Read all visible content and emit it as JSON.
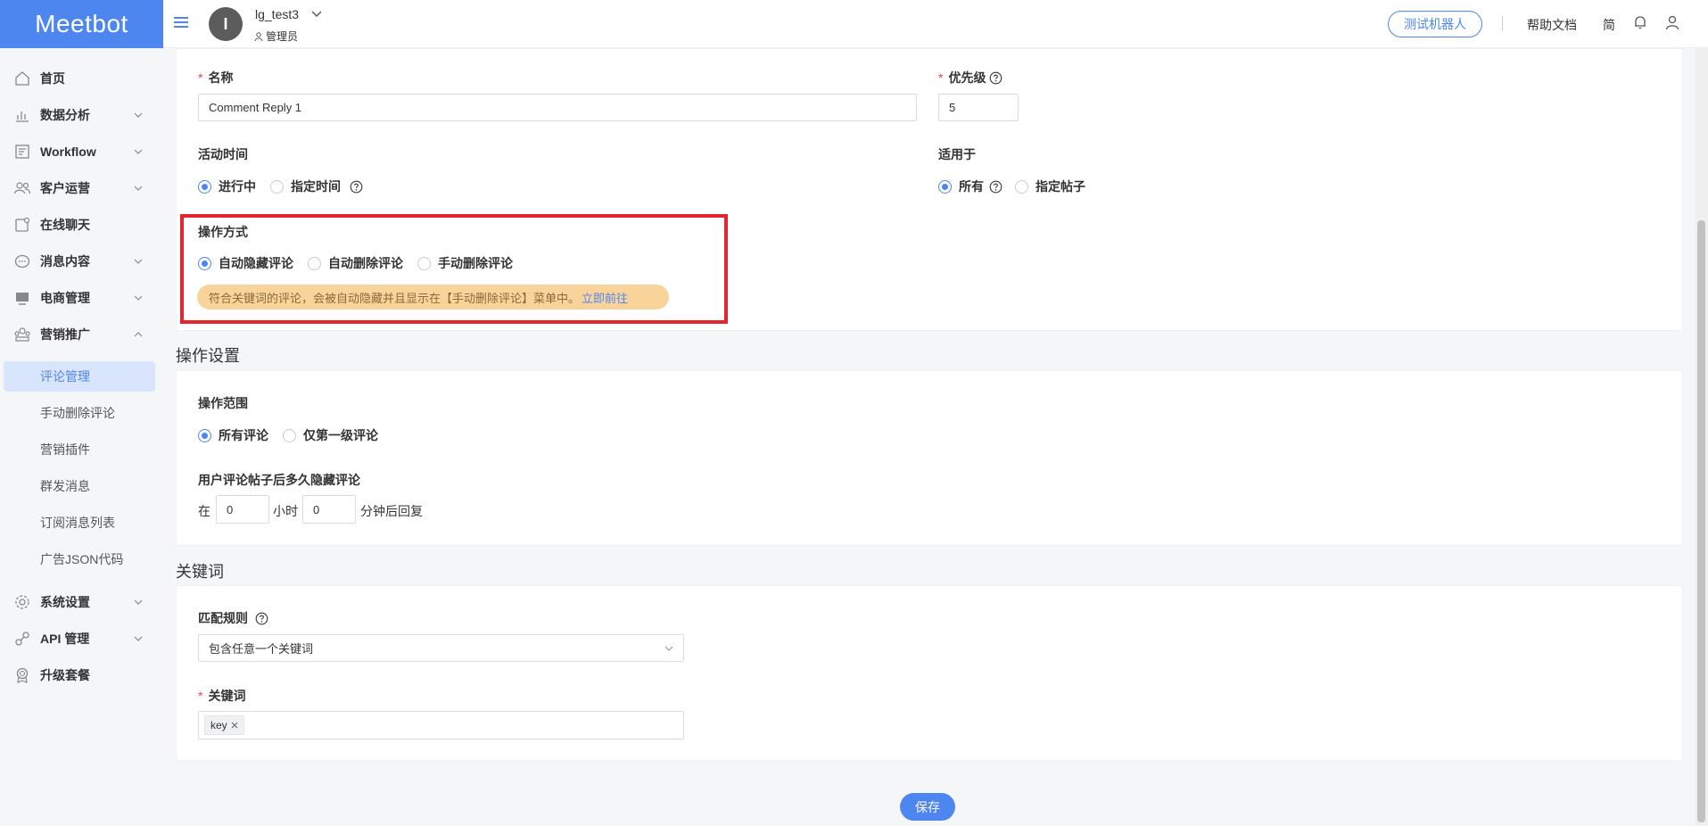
{
  "app": {
    "logo": "Meetbot"
  },
  "header": {
    "avatar_initial": "I",
    "username": "lg_test3",
    "role": "管理员",
    "test_robot": "测试机器人",
    "help_docs": "帮助文档",
    "language": "简"
  },
  "sidebar": {
    "items": [
      {
        "label": "首页",
        "icon": "home-icon"
      },
      {
        "label": "数据分析",
        "icon": "chart-icon"
      },
      {
        "label": "Workflow",
        "icon": "workflow-icon"
      },
      {
        "label": "客户运营",
        "icon": "users-icon"
      },
      {
        "label": "在线聊天",
        "icon": "chat-icon"
      },
      {
        "label": "消息内容",
        "icon": "message-icon"
      },
      {
        "label": "电商管理",
        "icon": "shop-icon"
      },
      {
        "label": "营销推广",
        "icon": "marketing-icon"
      },
      {
        "label": "系统设置",
        "icon": "gear-icon"
      },
      {
        "label": "API 管理",
        "icon": "api-icon"
      },
      {
        "label": "升级套餐",
        "icon": "badge-icon"
      }
    ],
    "sub_items": [
      {
        "label": "评论管理"
      },
      {
        "label": "手动删除评论"
      },
      {
        "label": "营销插件"
      },
      {
        "label": "群发消息"
      },
      {
        "label": "订阅消息列表"
      },
      {
        "label": "广告JSON代码"
      }
    ]
  },
  "form": {
    "name": {
      "label": "名称",
      "value": "Comment Reply 1"
    },
    "priority": {
      "label": "优先级",
      "value": "5"
    },
    "active_time": {
      "label": "活动时间",
      "options": [
        "进行中",
        "指定时间"
      ],
      "selected": "进行中"
    },
    "apply_to": {
      "label": "适用于",
      "options": [
        "所有",
        "指定帖子"
      ],
      "selected": "所有"
    },
    "operation_mode": {
      "label": "操作方式",
      "options": [
        "自动隐藏评论",
        "自动删除评论",
        "手动删除评论"
      ],
      "selected": "自动隐藏评论",
      "notice": "符合关键词的评论，会被自动隐藏并且显示在【手动删除评论】菜单中。",
      "notice_link": "立即前往"
    }
  },
  "operation_settings": {
    "title": "操作设置",
    "scope": {
      "label": "操作范围",
      "options": [
        "所有评论",
        "仅第一级评论"
      ],
      "selected": "所有评论"
    },
    "delay": {
      "label": "用户评论帖子后多久隐藏评论",
      "prefix": "在",
      "hours": "0",
      "hours_unit": "小时",
      "minutes": "0",
      "minutes_unit": "分钟后回复"
    }
  },
  "keywords": {
    "title": "关键词",
    "match_rule": {
      "label": "匹配规则",
      "value": "包含任意一个关键词"
    },
    "keyword": {
      "label": "关键词",
      "tags": [
        "key"
      ]
    }
  },
  "actions": {
    "save": "保存"
  },
  "colors": {
    "accent": "#4e86f0",
    "highlight_border": "#e3262d",
    "notice_bg": "#f9d49a"
  }
}
